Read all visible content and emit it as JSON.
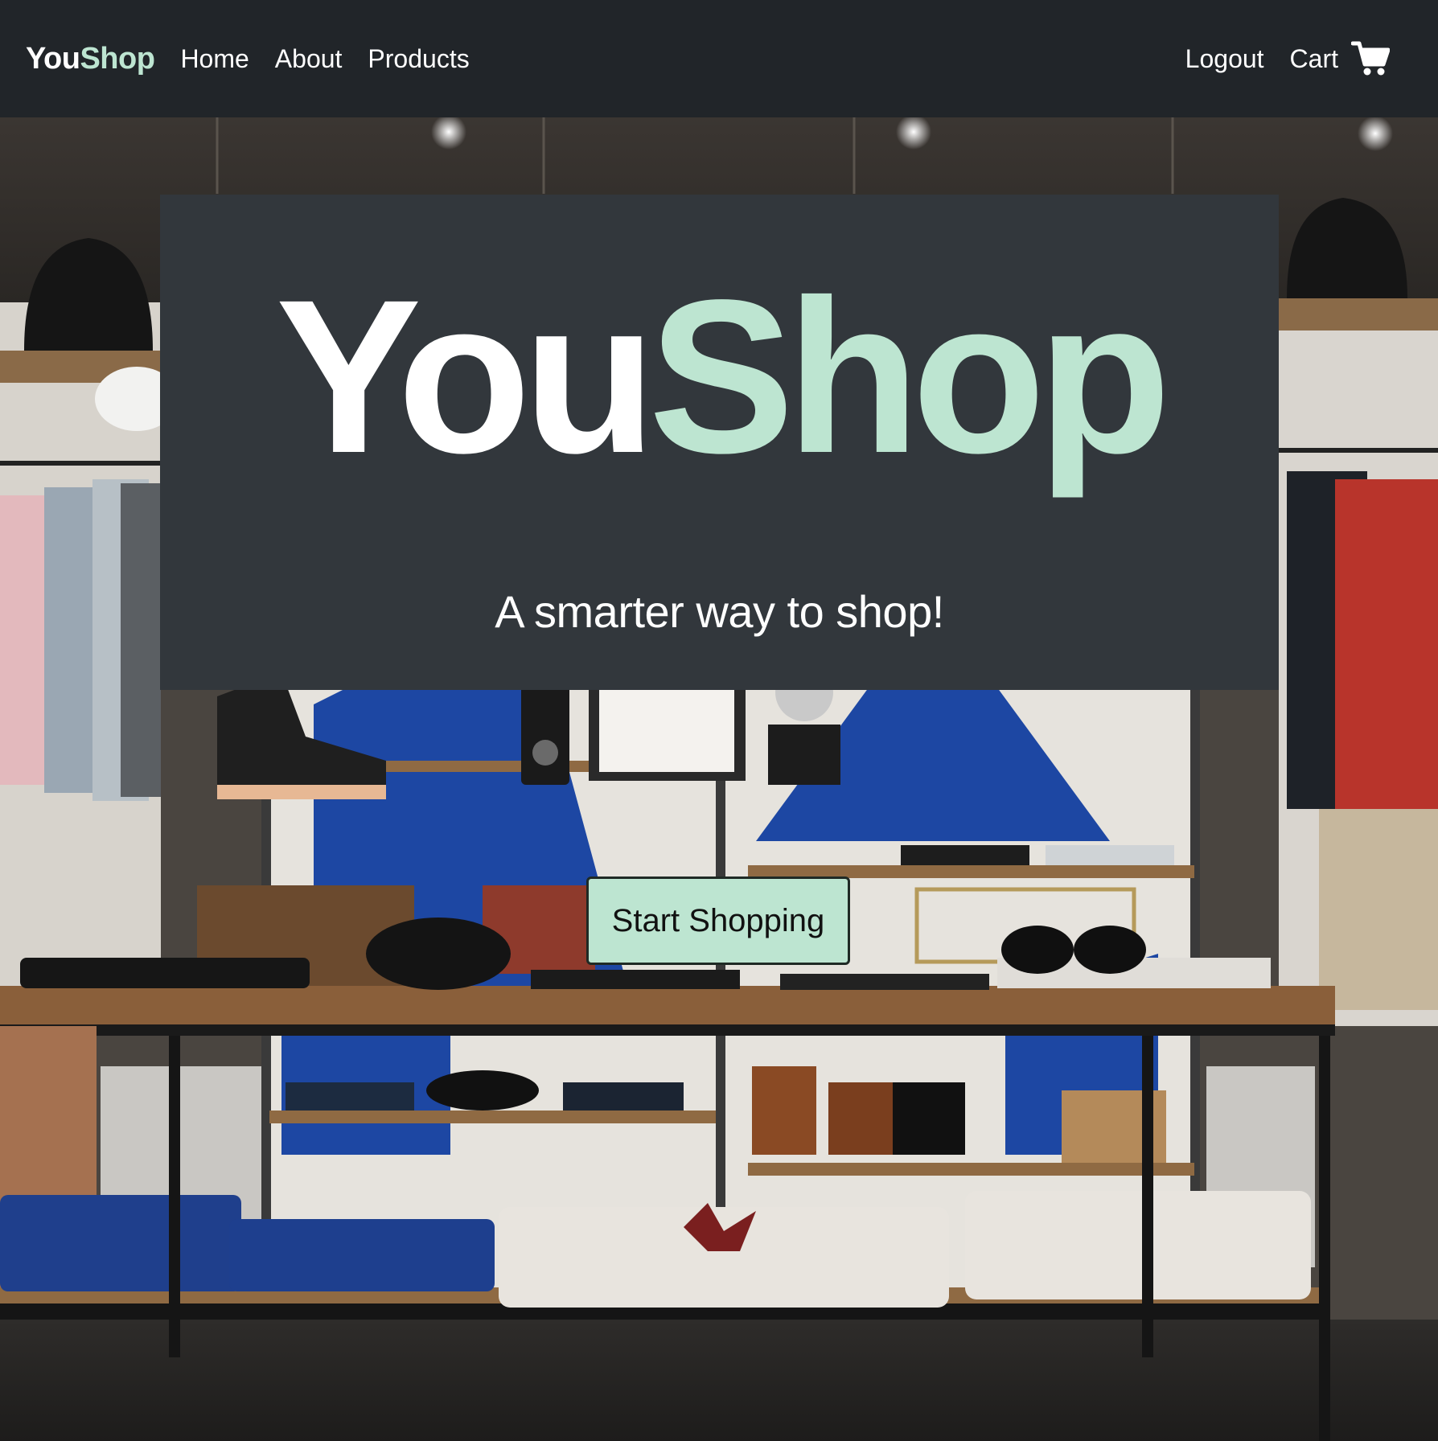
{
  "navbar": {
    "brand": {
      "part1": "You",
      "part2": "Shop"
    },
    "links": {
      "home": "Home",
      "about": "About",
      "products": "Products"
    },
    "right": {
      "logout": "Logout",
      "cart": "Cart",
      "cart_icon": "shopping-cart-icon"
    }
  },
  "hero": {
    "title": {
      "part1": "You",
      "part2": "Shop"
    },
    "subtitle": "A smarter way to shop!",
    "cta_label": "Start Shopping",
    "background_image": "clothing-store-interior-photo"
  },
  "colors": {
    "navbar_bg": "#212529",
    "card_bg": "#32373c",
    "accent": "#bde5d1",
    "text_light": "#ffffff"
  }
}
